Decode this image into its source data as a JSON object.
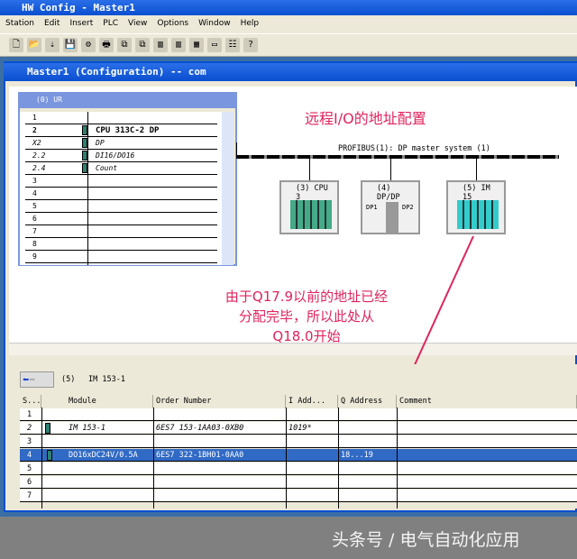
{
  "window": {
    "title": "HW Config - Master1",
    "inner_title": "Master1 (Configuration) -- com"
  },
  "menu": [
    "Station",
    "Edit",
    "Insert",
    "PLC",
    "View",
    "Options",
    "Window",
    "Help"
  ],
  "toolbar_icons": [
    "new-icon",
    "open-icon",
    "download-icon",
    "save-icon",
    "compile-icon",
    "print-icon",
    "copy-icon",
    "paste-icon",
    "station-icon",
    "station2-icon",
    "catalog-icon",
    "window-icon",
    "network-icon",
    "help-icon"
  ],
  "rack": {
    "title": "(0) UR",
    "rows": [
      {
        "slot": "1",
        "module": ""
      },
      {
        "slot": "2",
        "module": "CPU 313C-2 DP"
      },
      {
        "slot": "X2",
        "module": "DP"
      },
      {
        "slot": "2.2",
        "module": "DI16/DO16"
      },
      {
        "slot": "2.4",
        "module": "Count"
      },
      {
        "slot": "3",
        "module": ""
      },
      {
        "slot": "4",
        "module": ""
      },
      {
        "slot": "5",
        "module": ""
      },
      {
        "slot": "6",
        "module": ""
      },
      {
        "slot": "7",
        "module": ""
      },
      {
        "slot": "8",
        "module": ""
      },
      {
        "slot": "9",
        "module": ""
      }
    ]
  },
  "network": {
    "bus_label": "PROFIBUS(1): DP master system (1)",
    "stations": [
      "(3) CPU 3",
      "(4) DP/DP",
      "(5) IM 15"
    ],
    "dp1": "DP1",
    "dp2": "DP2"
  },
  "annotations": {
    "heading": "远程I/O的地址配置",
    "note_line1": "由于Q17.9以前的地址已经",
    "note_line2": "分配完毕，所以此处从",
    "note_line3": "Q18.0开始",
    "color": "#e0245e"
  },
  "detail": {
    "station_label": "(5)",
    "station_name": "IM 153-1",
    "columns": [
      "S...",
      "Module",
      "Order Number",
      "I Add...",
      "Q Address",
      "Comment"
    ],
    "rows": [
      {
        "slot": "1",
        "module": "",
        "order": "",
        "iadd": "",
        "qadd": "",
        "comment": ""
      },
      {
        "slot": "2",
        "module": "IM 153-1",
        "order": "6ES7 153-1AA03-0XB0",
        "iadd": "1019*",
        "qadd": "",
        "comment": ""
      },
      {
        "slot": "3",
        "module": "",
        "order": "",
        "iadd": "",
        "qadd": "",
        "comment": ""
      },
      {
        "slot": "4",
        "module": "DO16xDC24V/0.5A",
        "order": "6ES7 322-1BH01-0AA0",
        "iadd": "",
        "qadd": "18...19",
        "comment": ""
      },
      {
        "slot": "5",
        "module": "",
        "order": "",
        "iadd": "",
        "qadd": "",
        "comment": ""
      },
      {
        "slot": "6",
        "module": "",
        "order": "",
        "iadd": "",
        "qadd": "",
        "comment": ""
      },
      {
        "slot": "7",
        "module": "",
        "order": "",
        "iadd": "",
        "qadd": "",
        "comment": ""
      }
    ]
  },
  "watermark": "头条号 / 电气自动化应用"
}
